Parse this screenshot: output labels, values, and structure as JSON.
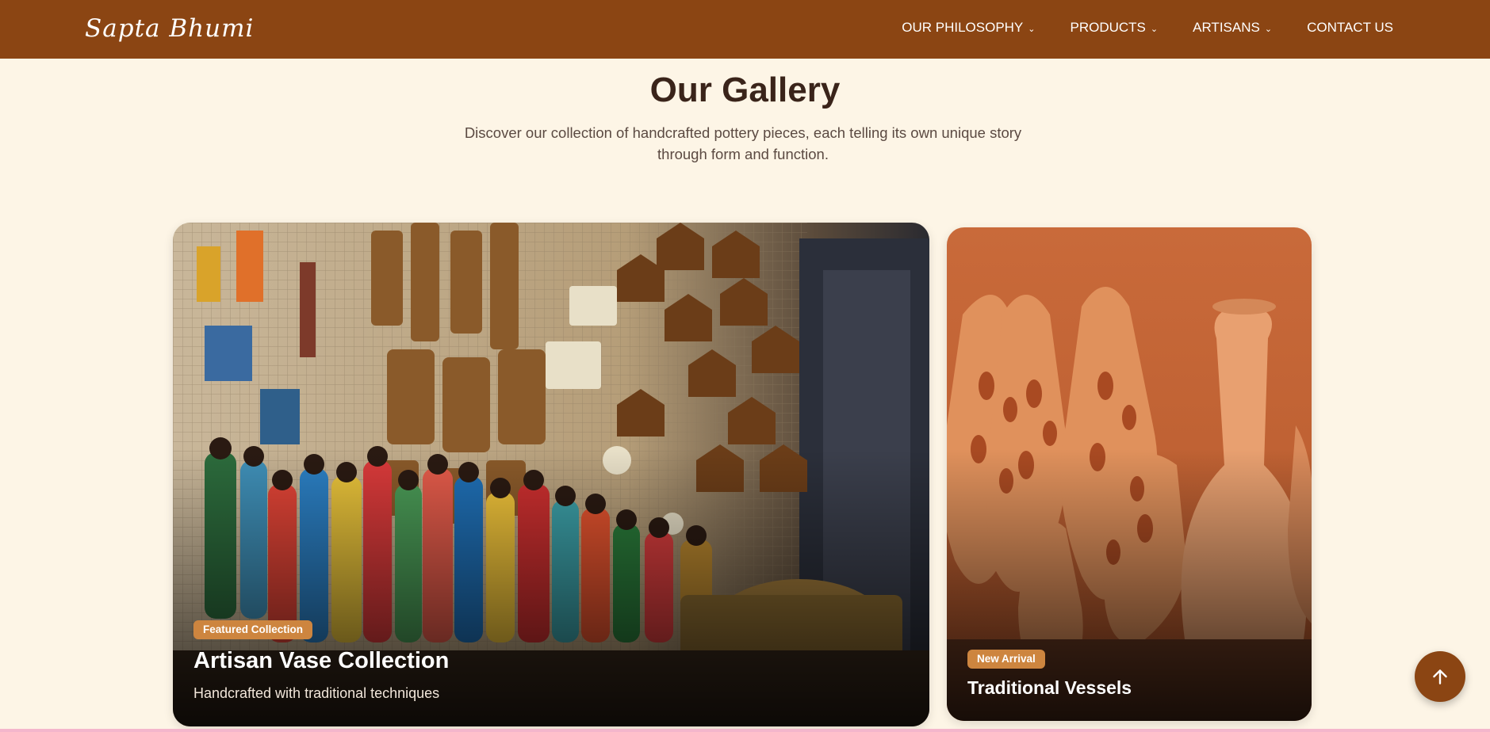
{
  "header": {
    "logo_text": "Sapta Bhumi",
    "nav": [
      {
        "label": "OUR PHILOSOPHY",
        "has_dropdown": true
      },
      {
        "label": "PRODUCTS",
        "has_dropdown": true
      },
      {
        "label": "ARTISANS",
        "has_dropdown": true
      },
      {
        "label": "CONTACT US",
        "has_dropdown": false
      }
    ],
    "dropdown_icon": "chevron-down-icon"
  },
  "gallery": {
    "title": "Our Gallery",
    "subtitle": "Discover our collection of handcrafted pottery pieces, each telling its own unique story through form and function."
  },
  "cards": [
    {
      "badge": "Featured Collection",
      "title": "Artisan Vase Collection",
      "description": "Handcrafted with traditional techniques"
    },
    {
      "badge": "New Arrival",
      "title": "Traditional Vessels"
    }
  ],
  "back_to_top": {
    "icon": "arrow-up-icon"
  },
  "colors": {
    "header": "#8b4513",
    "background": "#fdf5e6",
    "badge": "#cd853f",
    "heading": "#3a241a"
  }
}
